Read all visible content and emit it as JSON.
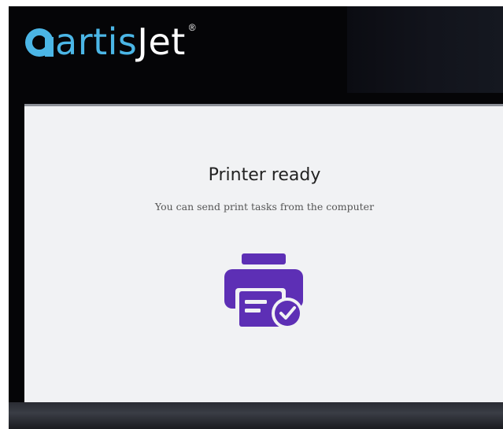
{
  "header": {
    "brand_part1": "artis",
    "brand_part2": "Jet",
    "brand_reg": "®",
    "brand_color": "#4bb6e6",
    "logo_icon": "artisjet-logo-icon"
  },
  "status": {
    "title": "Printer ready",
    "message": "You can send print tasks from the computer",
    "icon": "printer-ready-icon",
    "icon_color": "#5d2fb5"
  }
}
